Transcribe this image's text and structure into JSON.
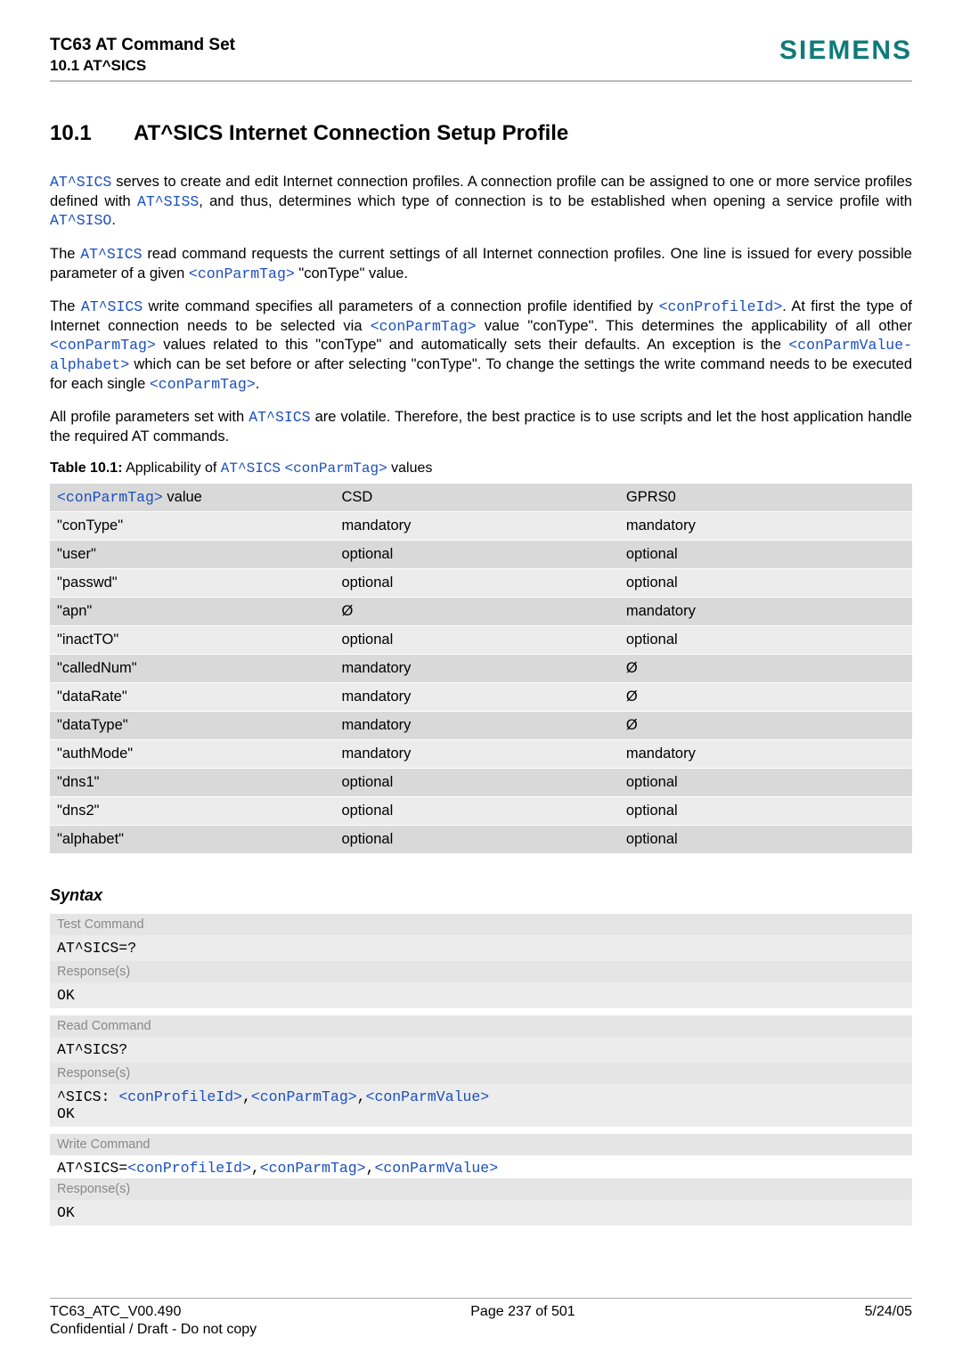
{
  "header": {
    "title": "TC63 AT Command Set",
    "subtitle": "10.1 AT^SICS",
    "brand": "SIEMENS"
  },
  "section": {
    "number": "10.1",
    "title": "AT^SICS   Internet Connection Setup Profile"
  },
  "para1_a": "AT^SICS",
  "para1_b": " serves to create and edit Internet connection profiles. A connection profile can be assigned to one or more service profiles defined with ",
  "para1_c": "AT^SISS",
  "para1_d": ", and thus, determines which type of connection is to be established when opening a service profile with ",
  "para1_e": "AT^SISO",
  "para1_f": ".",
  "para2_a": "The ",
  "para2_b": "AT^SICS",
  "para2_c": " read command requests the current settings of all Internet connection profiles. One line is issued for every possible parameter of a given ",
  "para2_d": "<conParmTag>",
  "para2_e": " \"conType\" value.",
  "para3_a": "The ",
  "para3_b": "AT^SICS",
  "para3_c": " write command specifies all parameters of a connection profile identified by ",
  "para3_d": "<conProfileId>",
  "para3_e": ". At first the type of Internet connection needs to be selected via ",
  "para3_f": "<conParmTag>",
  "para3_g": " value \"conType\". This determines the applicability of all other ",
  "para3_h": "<conParmTag>",
  "para3_i": " values related to this \"conType\" and automatically sets their defaults. An exception is the ",
  "para3_j": "<conParmValue-alphabet>",
  "para3_k": " which can be set before or after selecting \"conType\". To change the settings the write command needs to be executed for each single ",
  "para3_l": "<conParmTag>",
  "para3_m": ".",
  "para4_a": "All profile parameters set with ",
  "para4_b": "AT^SICS",
  "para4_c": " are volatile. Therefore, the best practice is to use scripts and let the host application handle the required AT commands.",
  "tableCaption_a": "Table 10.1:",
  "tableCaption_b": "  Applicability of ",
  "tableCaption_c": "AT^SICS",
  "tableCaption_d": " ",
  "tableCaption_e": "<conParmTag>",
  "tableCaption_f": " values",
  "table": {
    "h1a": "<conParmTag>",
    "h1b": " value",
    "h2": "CSD",
    "h3": "GPRS0",
    "rows": [
      {
        "c1": "\"conType\"",
        "c2": "mandatory",
        "c3": "mandatory"
      },
      {
        "c1": "\"user\"",
        "c2": "optional",
        "c3": "optional"
      },
      {
        "c1": "\"passwd\"",
        "c2": "optional",
        "c3": "optional"
      },
      {
        "c1": "\"apn\"",
        "c2": "Ø",
        "c3": "mandatory"
      },
      {
        "c1": "\"inactTO\"",
        "c2": "optional",
        "c3": "optional"
      },
      {
        "c1": "\"calledNum\"",
        "c2": "mandatory",
        "c3": "Ø"
      },
      {
        "c1": "\"dataRate\"",
        "c2": "mandatory",
        "c3": "Ø"
      },
      {
        "c1": "\"dataType\"",
        "c2": "mandatory",
        "c3": "Ø"
      },
      {
        "c1": "\"authMode\"",
        "c2": "mandatory",
        "c3": "mandatory"
      },
      {
        "c1": "\"dns1\"",
        "c2": "optional",
        "c3": "optional"
      },
      {
        "c1": "\"dns2\"",
        "c2": "optional",
        "c3": "optional"
      },
      {
        "c1": "\"alphabet\"",
        "c2": "optional",
        "c3": "optional"
      }
    ]
  },
  "syntaxTitle": "Syntax",
  "test": {
    "label": "Test Command",
    "cmd": "AT^SICS=?",
    "respLabel": "Response(s)",
    "resp": "OK"
  },
  "read": {
    "label": "Read Command",
    "cmd": "AT^SICS?",
    "respLabel": "Response(s)",
    "resp_prefix": "^SICS: ",
    "p1": "<conProfileId>",
    "sep1": ",",
    "p2": "<conParmTag>",
    "sep2": ",",
    "p3": "<conParmValue>",
    "ok": "OK"
  },
  "write": {
    "label": "Write Command",
    "prefix": "AT^SICS=",
    "p1": "<conProfileId>",
    "sep1": ",",
    "p2": "<conParmTag>",
    "sep2": ",",
    "p3": "<conParmValue>",
    "respLabel": "Response(s)",
    "ok": "OK"
  },
  "footer": {
    "left": "TC63_ATC_V00.490",
    "center": "Page 237 of 501",
    "right": "5/24/05",
    "conf": "Confidential / Draft - Do not copy"
  }
}
